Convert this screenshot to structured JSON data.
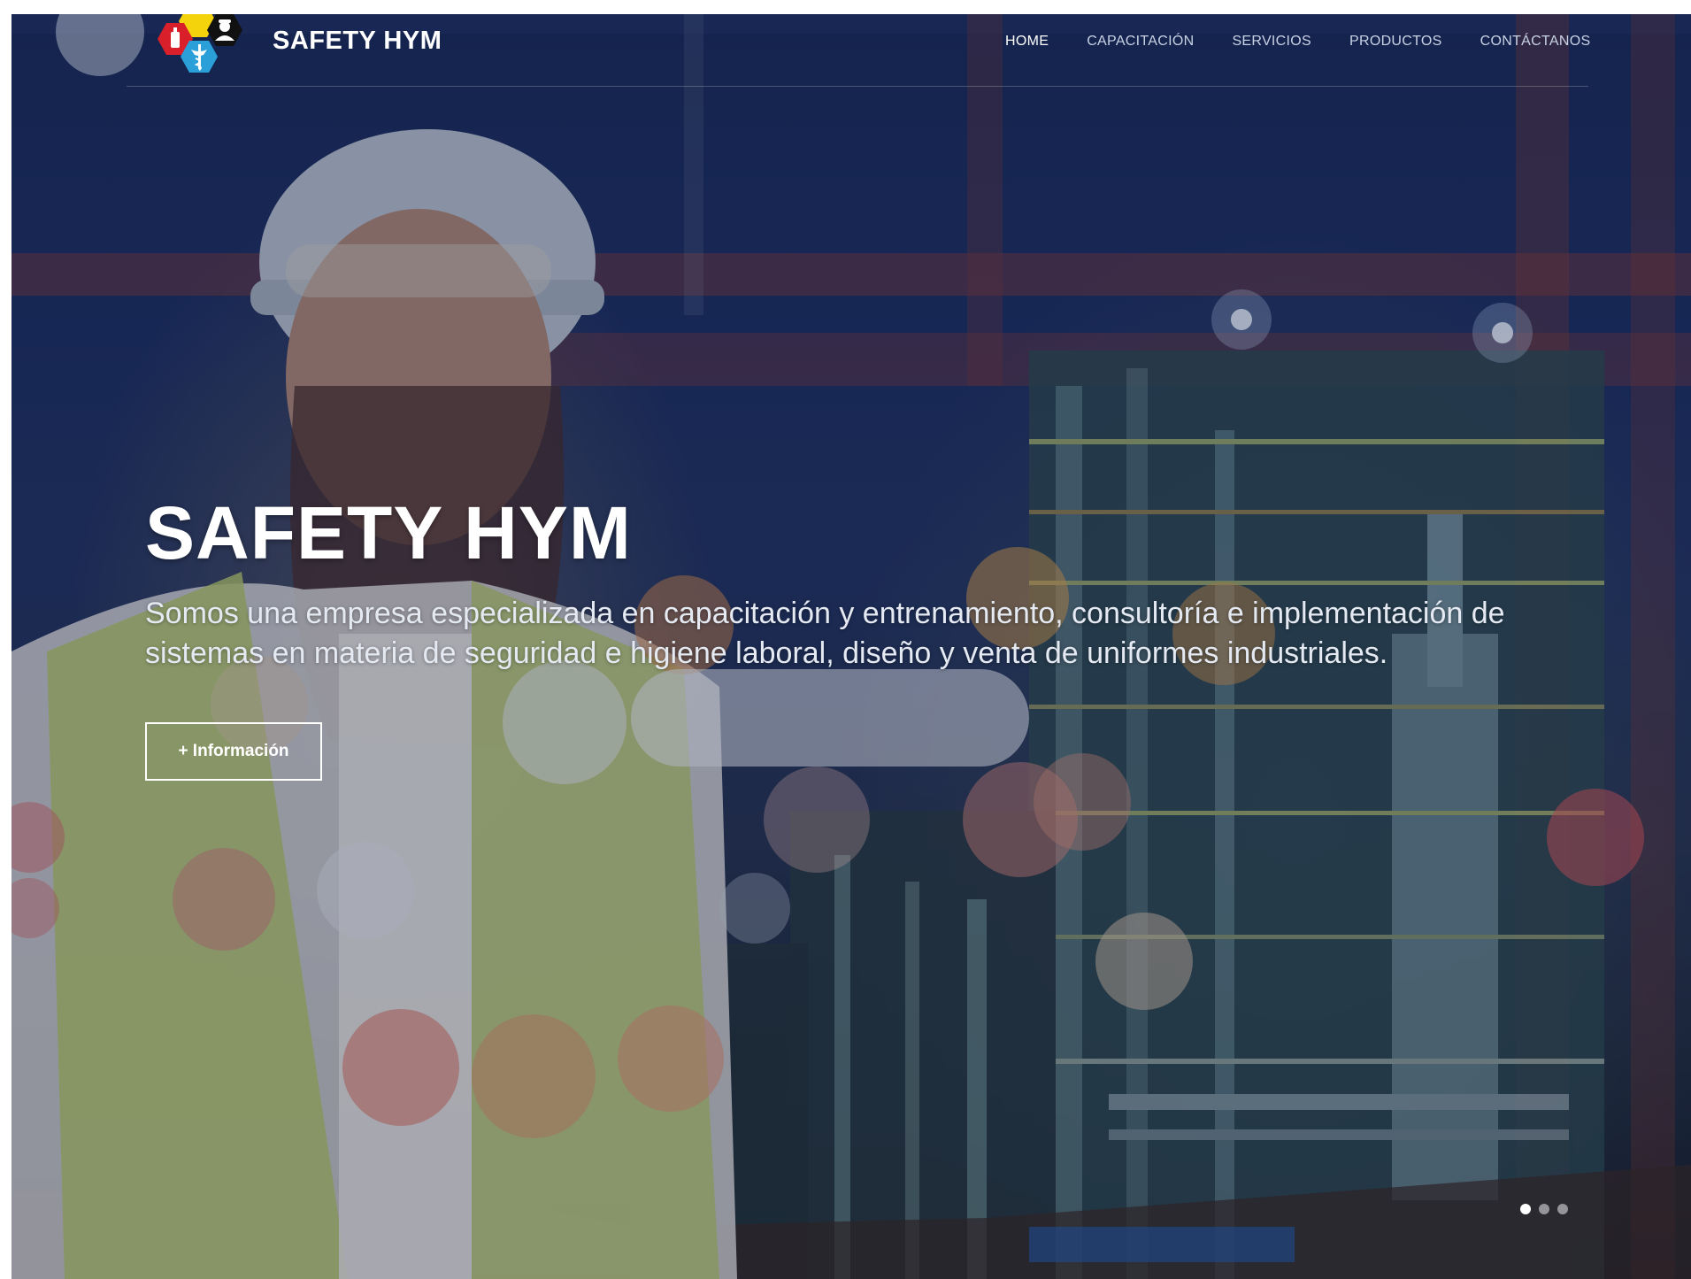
{
  "header": {
    "brand_name": "SAFETY HYM",
    "nav": [
      {
        "label": "HOME",
        "active": true
      },
      {
        "label": "CAPACITACIÓN",
        "active": false
      },
      {
        "label": "SERVICIOS",
        "active": false
      },
      {
        "label": "PRODUCTOS",
        "active": false
      },
      {
        "label": "CONTÁCTANOS",
        "active": false
      }
    ]
  },
  "hero": {
    "title": "SAFETY HYM",
    "description": "Somos una empresa especializada en capacitación y entrenamiento, consultoría e implementación de sistemas en materia de seguridad e higiene laboral, diseño y venta de uniformes industriales.",
    "button_label": "+ Información",
    "slides": {
      "count": 3,
      "active_index": 0
    }
  },
  "colors": {
    "logo_red": "#d9202a",
    "logo_yellow": "#f4d20c",
    "logo_blue": "#2a9fd8",
    "logo_black": "#111111",
    "text_white": "#ffffff",
    "nav_inactive": "#c9d2e4"
  },
  "icons": {
    "logo": "hexagon-cluster-safety-logo",
    "logo_parts": [
      "fire-extinguisher-icon",
      "caduceus-icon",
      "worker-icon"
    ]
  }
}
